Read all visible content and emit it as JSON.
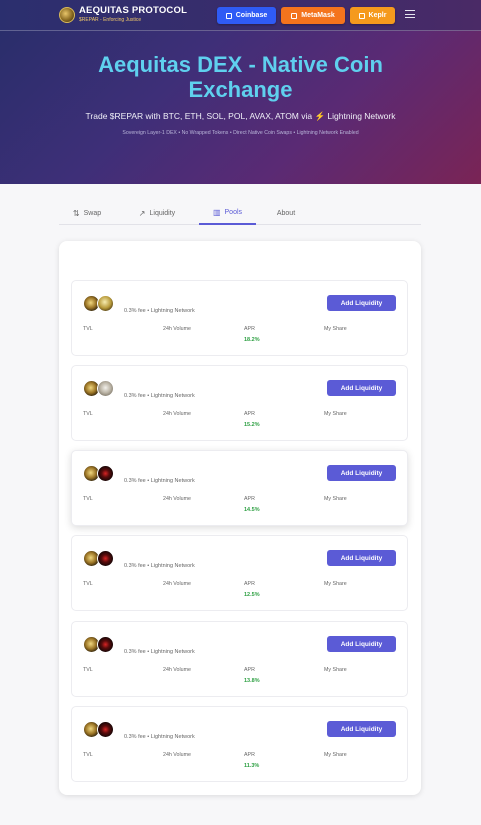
{
  "header": {
    "brand_title": "AEQUITAS PROTOCOL",
    "brand_subtitle": "$REPAR - Enforcing Justice",
    "wallets": [
      {
        "label": "Coinbase",
        "color": "#2f5bf5"
      },
      {
        "label": "MetaMask",
        "color": "#f4741d"
      },
      {
        "label": "Keplr",
        "color": "#f59a1d"
      }
    ],
    "menu_icon": "hamburger-icon"
  },
  "hero": {
    "title": "Aequitas DEX - Native Coin Exchange",
    "subtitle": "Trade $REPAR with BTC, ETH, SOL, POL, AVAX, ATOM via ⚡ Lightning Network",
    "note": "Sovereign Layer-1 DEX • No Wrapped Tokens • Direct Native Coin Swaps • Lightning Network Enabled"
  },
  "tabs": [
    {
      "label": "Swap",
      "icon": "⇅",
      "active": false
    },
    {
      "label": "Liquidity",
      "icon": "↗",
      "active": false
    },
    {
      "label": "Pools",
      "icon": "▥",
      "active": true
    },
    {
      "label": "About",
      "icon": "",
      "active": false
    }
  ],
  "pool_labels": {
    "fee": "0.3% fee • Lightning Network",
    "add_button": "Add Liquidity",
    "tvl": "TVL",
    "volume": "24h Volume",
    "apr": "APR",
    "share": "My Share"
  },
  "pools": [
    {
      "token_b": "btc",
      "apr": "18.2%"
    },
    {
      "token_b": "eth",
      "apr": "15.2%"
    },
    {
      "token_b": "red",
      "apr": "14.5%"
    },
    {
      "token_b": "red",
      "apr": "12.5%"
    },
    {
      "token_b": "red",
      "apr": "13.8%"
    },
    {
      "token_b": "red",
      "apr": "11.3%"
    }
  ],
  "colors": {
    "accent": "#5b5bd6",
    "apr_green": "#2ea043",
    "hero_title": "#5fd0ee"
  }
}
